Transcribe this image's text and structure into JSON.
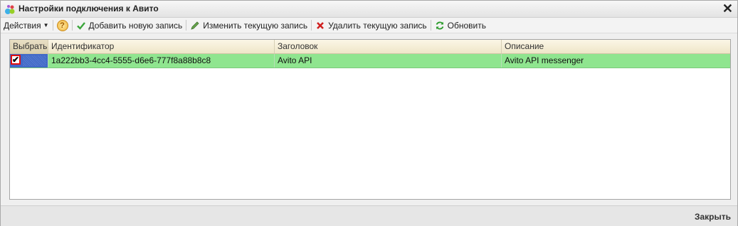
{
  "window": {
    "title": "Настройки подключения к Авито",
    "close_glyph": "✕"
  },
  "toolbar": {
    "actions_label": "Действия",
    "help_glyph": "?",
    "add_label": "Добавить новую запись",
    "edit_label": "Изменить текущую запись",
    "delete_label": "Удалить текущую запись",
    "refresh_label": "Обновить"
  },
  "table": {
    "columns": [
      "Выбрать",
      "Идентификатор",
      "Заголовок",
      "Описание"
    ],
    "rows": [
      {
        "selected": true,
        "id": "1a222bb3-4cc4-5555-d6e6-777f8a88b8c8",
        "title": "Avito API",
        "description": "Avito API messenger"
      }
    ]
  },
  "footer": {
    "close_label": "Закрыть"
  },
  "colors": {
    "row_highlight": "#8fe58f",
    "selection": "#4169c8",
    "add_icon": "#3aa53a",
    "delete_icon": "#d02020",
    "refresh_icon": "#2a9a2a"
  }
}
